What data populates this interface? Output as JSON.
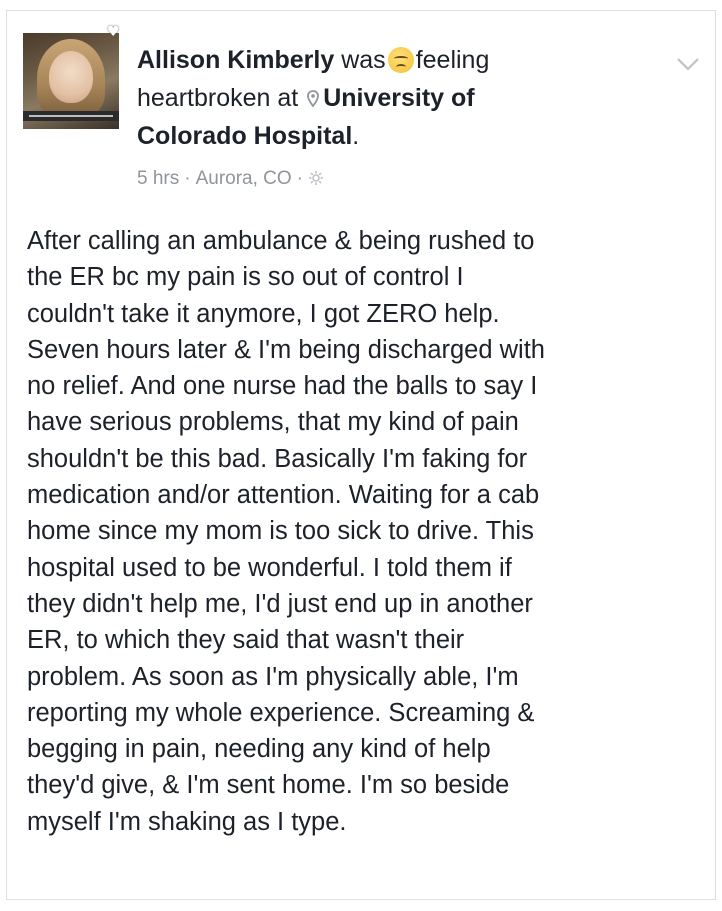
{
  "post": {
    "author": "Allison Kimberly",
    "was": "was",
    "feeling_word": "feeling",
    "feeling_state": "heartbroken",
    "at": "at",
    "location_line1": "University of",
    "location_line2": "Colorado Hospital",
    "period": ".",
    "timestamp": "5 hrs",
    "separator": "·",
    "place": "Aurora, CO",
    "audience_icon": "gear-icon",
    "feeling_icon": "sad-emoji-icon",
    "location_icon": "pin-icon",
    "body": "After calling an ambulance & being rushed to\nthe ER bc my pain is so out of control I\ncouldn't take it anymore, I got ZERO help.\nSeven hours later & I'm being discharged with\nno relief. And one nurse had the balls to say I\nhave serious problems, that my kind of pain\nshouldn't be this bad. Basically I'm faking for\nmedication and/or attention. Waiting for a cab\nhome since my mom is too sick to drive. This\nhospital used to be wonderful. I told them if\nthey didn't help me, I'd just end up in another\nER, to which they said that wasn't their\nproblem. As soon as I'm physically able, I'm\nreporting my whole experience. Screaming &\nbegging in pain, needing any kind of help\nthey'd give, & I'm sent home. I'm so beside\nmyself I'm shaking as I type."
  },
  "colors": {
    "text": "#1d2129",
    "meta": "#90949c",
    "border": "#dddfe2"
  }
}
